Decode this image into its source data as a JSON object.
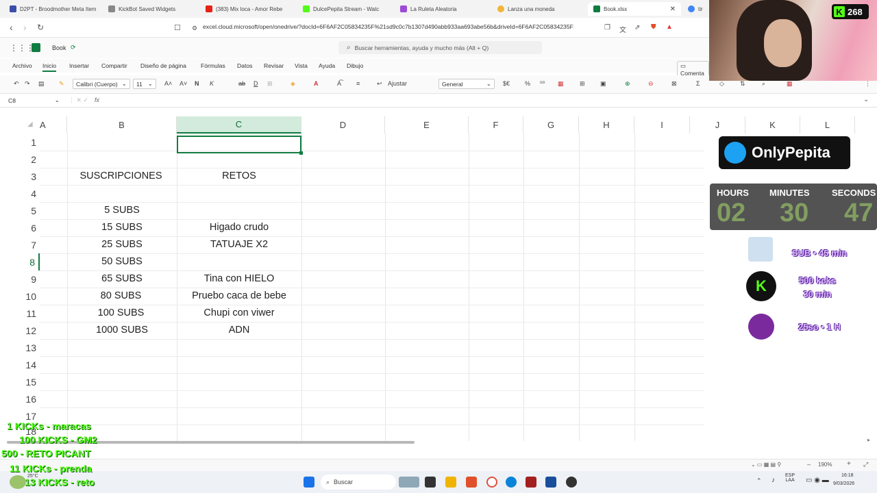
{
  "browser": {
    "tabs": [
      {
        "label": "D2PT - Broodmother Meta Item",
        "color": "#3b4ea8"
      },
      {
        "label": "KickBot Saved Widgets",
        "color": "#888888"
      },
      {
        "label": "(383) Mix loca - Amor Rebe",
        "color": "#e62117"
      },
      {
        "label": "DulcePepita Stream - Watc",
        "color": "#53fc18"
      },
      {
        "label": "La Ruleta Aleatoria",
        "color": "#9b4bd6"
      },
      {
        "label": "Lanza una moneda",
        "color": "#f2b43a"
      },
      {
        "label": "Book.xlsx",
        "color": "#107c41"
      },
      {
        "label": "tir",
        "color": "#4285f4"
      }
    ],
    "url": "excel.cloud.microsoft/open/onedrive/?docId=6F6AF2C05834235F%21sd9c0c7b1307d490abb933aa693abe56b&driveId=6F6AF2C05834235F"
  },
  "excel": {
    "book_name": "Book",
    "search_placeholder": "Buscar herramientas, ayuda y mucho más (Alt + Q)",
    "menu": [
      "Archivo",
      "Inicio",
      "Insertar",
      "Compartir",
      "Diseño de página",
      "Fórmulas",
      "Datos",
      "Revisar",
      "Vista",
      "Ayuda",
      "Dibujo"
    ],
    "comment_label": "Comenta",
    "font_name": "Calibri (Cuerpo)",
    "font_size": "11",
    "wrap_label": "Ajustar",
    "number_format": "General",
    "name_box": "C8",
    "fx": "fx",
    "columns": [
      "A",
      "B",
      "C",
      "D",
      "E",
      "F",
      "G",
      "H",
      "I",
      "J",
      "K",
      "L"
    ],
    "rows": [
      "1",
      "2",
      "3",
      "4",
      "5",
      "6",
      "7",
      "8",
      "9",
      "10",
      "11",
      "12",
      "13",
      "14",
      "15",
      "16",
      "17",
      "18"
    ],
    "cells": {
      "B3": "SUSCRIPCIONES",
      "C3": "RETOS",
      "B5": "5 SUBS",
      "B6": "15 SUBS",
      "C6": "Higado crudo",
      "B7": "25 SUBS",
      "C7": "TATUAJE X2",
      "B8": "50 SUBS",
      "B9": "65 SUBS",
      "C9": "Tina con HIELO",
      "B10": "80 SUBS",
      "C10": "Pruebo caca de bebe",
      "B11": "100 SUBS",
      "C11": "Chupi con viwer",
      "B12": "1000 SUBS",
      "C12": "ADN"
    },
    "zoom": "190%"
  },
  "overlay": {
    "brand": "OnlyPepita",
    "kick_count": "268",
    "timer": {
      "hours_label": "HOURS",
      "minutes_label": "MINUTES",
      "seconds_label": "SECONDS",
      "hours": "02",
      "minutes": "30",
      "seconds": "47"
    },
    "rewards": [
      "SUB • 45 min",
      "500 kcks\n30 min",
      "25so • 1 H"
    ],
    "kick_rewards": [
      "1 KICKs - maracas",
      "100 KICKS - GM2",
      "500 - RETO PICANT",
      "11 KICKs - prenda",
      "13 KICKS - reto"
    ]
  },
  "taskbar": {
    "search_label": "Buscar",
    "lang": "ESP\nLAA",
    "time": "16:18",
    "date": "9/03/2026",
    "temp": "25°C"
  }
}
